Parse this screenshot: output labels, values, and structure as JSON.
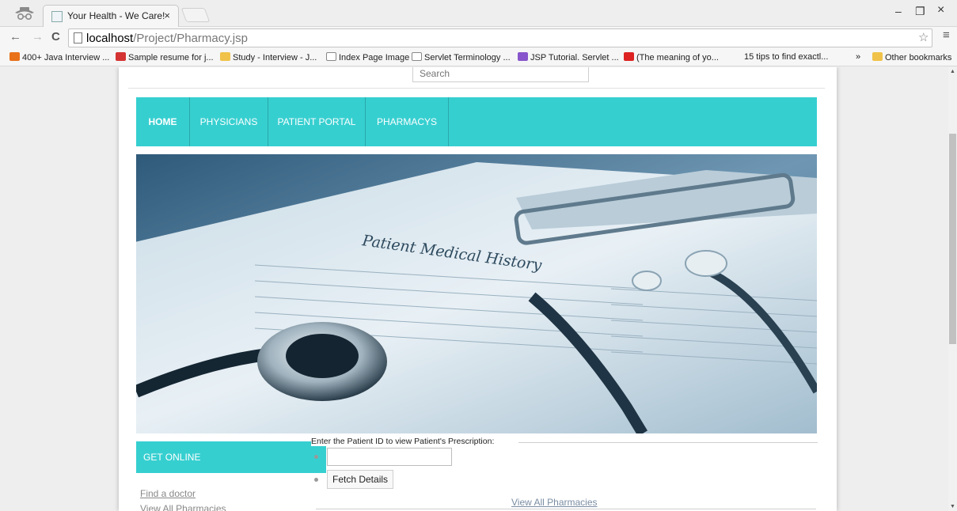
{
  "browser": {
    "tab_title": "Your Health - We Care!",
    "tab_close": "×",
    "url_host": "localhost",
    "url_path": "/Project/Pharmacy.jsp",
    "window_controls": [
      "–",
      "❐",
      "×"
    ]
  },
  "bookmarks": [
    {
      "label": "400+ Java Interview ...",
      "icon_color": "#e8711a"
    },
    {
      "label": "Sample resume for j...",
      "icon_color": "#d43333"
    },
    {
      "label": "Study - Interview - J...",
      "icon_color": "#f0c24a"
    },
    {
      "label": "Index Page Image",
      "icon_color": "#ffffff"
    },
    {
      "label": "Servlet Terminology ...",
      "icon_color": "#ffffff"
    },
    {
      "label": "JSP Tutorial. Servlet ...",
      "icon_color": "#8855cc"
    },
    {
      "label": "(The meaning of yo...",
      "icon_color": "#dd2222"
    },
    {
      "label": "15 tips to find exactl...",
      "icon_color": "#ffffff"
    }
  ],
  "bookmarks_overflow": "»",
  "other_bookmarks": "Other bookmarks",
  "search": {
    "placeholder": "Search"
  },
  "nav": {
    "items": [
      "HOME",
      "PHYSICIANS",
      "PATIENT PORTAL",
      "PHARMACYS"
    ],
    "color": "#36cfd0"
  },
  "hero": {
    "title": "Patient Medical History"
  },
  "sidebar": {
    "heading": "GET ONLINE",
    "links": [
      "Find a doctor",
      "View All Pharmacies"
    ]
  },
  "form": {
    "legend": "Enter the Patient ID to view Patient's Prescription:",
    "patient_id_value": "",
    "button": "Fetch Details",
    "view_all": "View All Pharmacies"
  }
}
